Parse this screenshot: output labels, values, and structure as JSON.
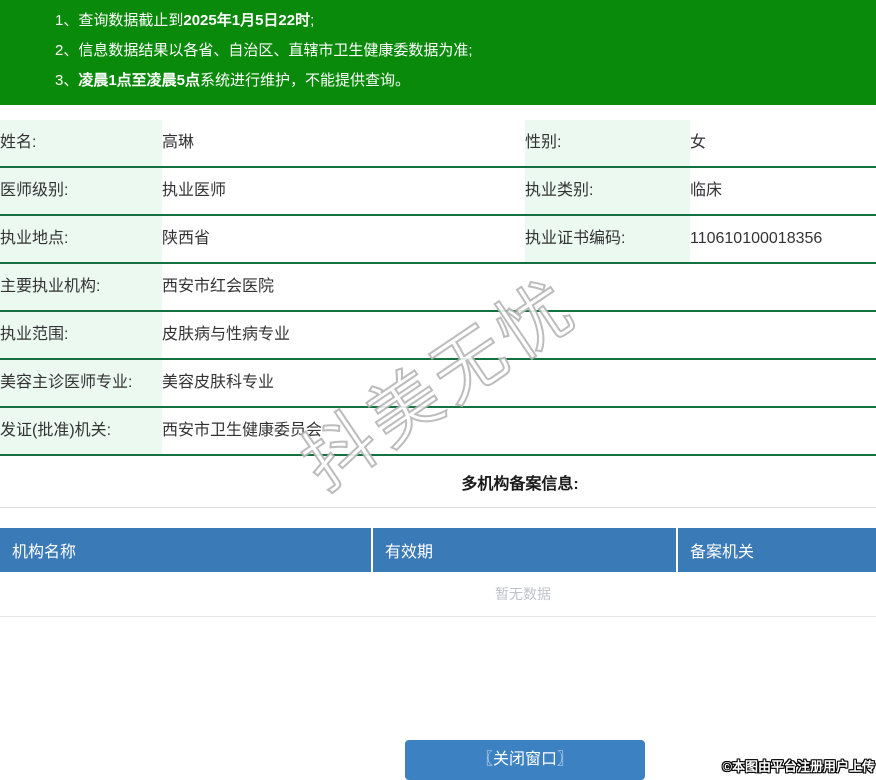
{
  "colors": {
    "notice_bg": "#0a8a0a",
    "label_bg": "#ebf9f1",
    "row_border": "#15713f",
    "table_header_bg": "#3a7ab6",
    "button_bg": "#3c82c3",
    "empty_text": "#bfc3ca"
  },
  "notice": {
    "items": [
      {
        "num": "1、",
        "pre": "查询数据截止到",
        "bold": "2025年1月5日22时",
        "post": ";"
      },
      {
        "num": "2、",
        "pre": "信息数据结果以各省、自治区、直辖市卫生健康委数据为准;",
        "bold": "",
        "post": ""
      },
      {
        "num": "3、",
        "pre": "",
        "bold": "凌晨1点至凌晨5点",
        "post": "系统进行维护，不能提供查询。"
      }
    ]
  },
  "info": {
    "rows": [
      {
        "l1": "姓名:",
        "v1": "高琳",
        "l2": "性别:",
        "v2": "女"
      },
      {
        "l1": "医师级别:",
        "v1": "执业医师",
        "l2": "执业类别:",
        "v2": "临床"
      },
      {
        "l1": "执业地点:",
        "v1": "陕西省",
        "l2": "执业证书编码:",
        "v2": "110610100018356"
      },
      {
        "l1": "主要执业机构:",
        "v1": "西安市红会医院"
      },
      {
        "l1": "执业范围:",
        "v1": "皮肤病与性病专业"
      },
      {
        "l1": "美容主诊医师专业:",
        "v1": "美容皮肤科专业"
      },
      {
        "l1": "发证(批准)机关:",
        "v1": "西安市卫生健康委员会"
      }
    ]
  },
  "records": {
    "section_title": "多机构备案信息:",
    "columns": [
      "机构名称",
      "有效期",
      "备案机关"
    ],
    "empty": "暂无数据"
  },
  "footer": {
    "close_label": "〖关闭窗口〗",
    "copyright": "©本图由平台注册用户上传"
  },
  "watermark_text": "抖美无忧"
}
